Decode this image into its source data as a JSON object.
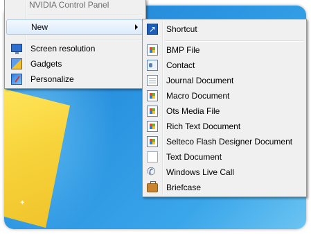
{
  "context_menu": {
    "items": [
      {
        "label": "NVIDIA Control Panel"
      },
      {
        "label": "New"
      },
      {
        "label": "Screen resolution"
      },
      {
        "label": "Gadgets"
      },
      {
        "label": "Personalize"
      }
    ]
  },
  "new_submenu": {
    "items": [
      {
        "label": "Shortcut",
        "icon": "shortcut-icon"
      },
      {
        "label": "BMP File",
        "icon": "bmp-file-icon"
      },
      {
        "label": "Contact",
        "icon": "contact-icon"
      },
      {
        "label": "Journal Document",
        "icon": "journal-document-icon"
      },
      {
        "label": "Macro Document",
        "icon": "macro-document-icon"
      },
      {
        "label": "Ots Media File",
        "icon": "ots-media-file-icon"
      },
      {
        "label": "Rich Text Document",
        "icon": "rich-text-document-icon"
      },
      {
        "label": "Selteco Flash Designer Document",
        "icon": "flash-designer-document-icon"
      },
      {
        "label": "Text Document",
        "icon": "text-document-icon"
      },
      {
        "label": "Windows Live Call",
        "icon": "windows-live-call-icon"
      },
      {
        "label": "Briefcase",
        "icon": "briefcase-icon"
      }
    ]
  },
  "colors": {
    "desktop_blue": "#2a93e0",
    "menu_background": "#f0f0f0",
    "highlight_border": "#a8c8ec"
  }
}
